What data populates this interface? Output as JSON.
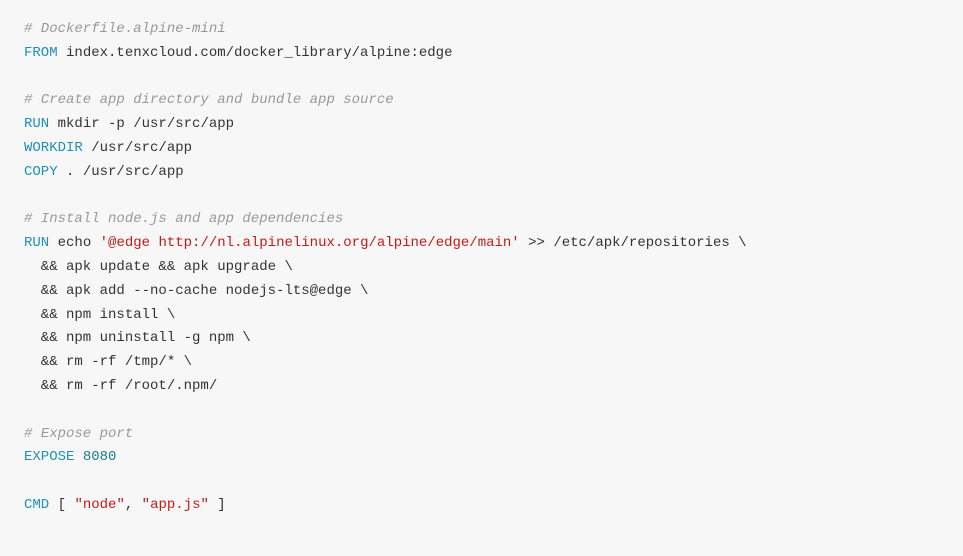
{
  "lines": {
    "l1": "# Dockerfile.alpine-mini",
    "l2_kw": "FROM",
    "l2_txt": " index.tenxcloud.com/docker_library/alpine:edge",
    "l3": "# Create app directory and bundle app source",
    "l4_kw": "RUN",
    "l4_txt": " mkdir -p /usr/src/app",
    "l5_kw": "WORKDIR",
    "l5_txt": " /usr/src/app",
    "l6_kw": "COPY",
    "l6_txt": " . /usr/src/app",
    "l7": "# Install node.js and app dependencies",
    "l8_kw": "RUN",
    "l8_txt1": " echo ",
    "l8_str": "'@edge http://nl.alpinelinux.org/alpine/edge/main'",
    "l8_txt2": " >> /etc/apk/repositories \\",
    "l9": "  && apk update && apk upgrade \\",
    "l10": "  && apk add --no-cache nodejs-lts@edge \\",
    "l11": "  && npm install \\",
    "l12": "  && npm uninstall -g npm \\",
    "l13": "  && rm -rf /tmp/* \\",
    "l14": "  && rm -rf /root/.npm/",
    "l15": "# Expose port",
    "l16_kw": "EXPOSE",
    "l16_num": "8080",
    "l16_sp": " ",
    "l17_kw": "CMD",
    "l17_txt1": " [ ",
    "l17_str1": "\"node\"",
    "l17_txt2": ", ",
    "l17_str2": "\"app.js\"",
    "l17_txt3": " ]"
  }
}
